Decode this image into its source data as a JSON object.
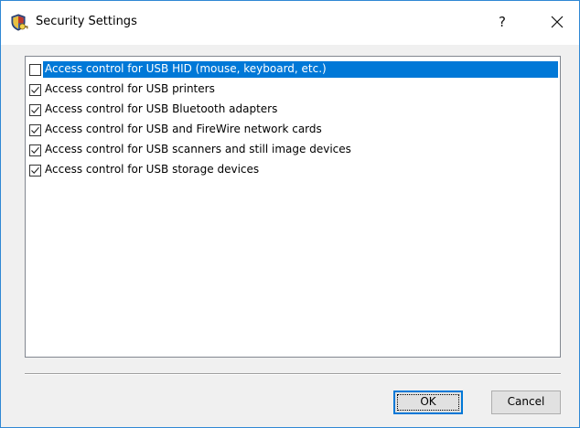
{
  "window": {
    "title": "Security Settings",
    "help_label": "?",
    "title_icon": "shield-key-icon",
    "close_icon": "close-icon"
  },
  "list": {
    "items": [
      {
        "label": "Access control for USB HID (mouse, keyboard, etc.)",
        "checked": false,
        "selected": true
      },
      {
        "label": "Access control for USB printers",
        "checked": true,
        "selected": false
      },
      {
        "label": "Access control for USB Bluetooth adapters",
        "checked": true,
        "selected": false
      },
      {
        "label": "Access control for USB and FireWire network cards",
        "checked": true,
        "selected": false
      },
      {
        "label": "Access control for USB scanners and still image devices",
        "checked": true,
        "selected": false
      },
      {
        "label": "Access control for USB storage devices",
        "checked": true,
        "selected": false
      }
    ]
  },
  "buttons": {
    "ok_label": "OK",
    "cancel_label": "Cancel"
  },
  "colors": {
    "selection": "#0078d7",
    "window_border": "#2f88d4",
    "dialog_background": "#f0f0f0"
  }
}
